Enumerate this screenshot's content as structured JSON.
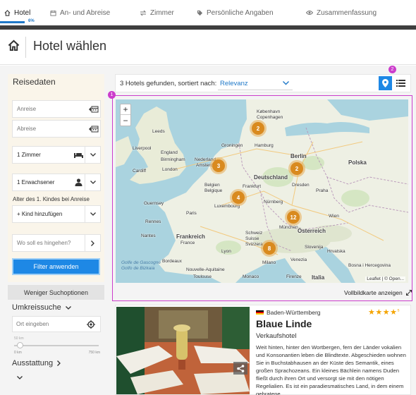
{
  "steps": [
    {
      "label": "Hotel",
      "icon": "home-icon",
      "active": true
    },
    {
      "label": "An- und Abreise",
      "icon": "calendar-icon"
    },
    {
      "label": "Zimmer",
      "icon": "exchange-icon"
    },
    {
      "label": "Persönliche Angaben",
      "icon": "tag-icon"
    },
    {
      "label": "Zusammenfassung",
      "icon": "eye-icon"
    }
  ],
  "progress": {
    "label": "6%",
    "value": 6
  },
  "page": {
    "title": "Hotel wählen"
  },
  "sidebar": {
    "title": "Reisedaten",
    "arrival_placeholder": "Anreise",
    "departure_placeholder": "Abreise",
    "rooms_value": "1 Zimmer",
    "guests_value": "1 Erwachsener",
    "kids_label": "Alter des 1. Kindes bei Anreise",
    "add_child_value": "+ Kind hinzufügen",
    "destination_placeholder": "Wo soll es hingehen?",
    "apply_label": "Filter anwenden"
  },
  "filters": {
    "fewer_label": "Weniger Suchoptionen",
    "area_search_title": "Umkreissuche",
    "location_placeholder": "Ort eingeben",
    "radius": {
      "current": "50 km",
      "min": "0 km",
      "max": "750 km",
      "value_km": 50
    },
    "amenities_title": "Ausstattung"
  },
  "results": {
    "count_text": "3 Hotels gefunden, sortiert nach:",
    "sort_value": "Relevanz",
    "badges": {
      "map": "1",
      "toggle": "2"
    }
  },
  "map": {
    "zoom_in": "+",
    "zoom_out": "−",
    "clusters": [
      "2",
      "3",
      "2",
      "4",
      "12",
      "8"
    ],
    "labels": {
      "kobenhavn": "København",
      "copenhagen": "Copenhagen",
      "hamburg": "Hamburg",
      "groningen": "Groningen",
      "berlin": "Berlin",
      "nederland": "Nederland",
      "amsterdam": "Amsterdam",
      "polska": "Polska",
      "leeds": "Leeds",
      "liverpool": "Liverpool",
      "england": "England",
      "birmingham": "Birmingham",
      "london": "London",
      "cardiff": "Cardiff",
      "belgien": "Belgien",
      "belgique": "Belgique",
      "deutschland": "Deutschland",
      "dresden": "Dresden",
      "praha": "Praha",
      "frankfurt": "Frankfurt",
      "guernsey": "Guernsey",
      "luxembourg": "Luxembourg",
      "nurnberg": "Nürnberg",
      "rennes": "Rennes",
      "paris": "Paris",
      "munchen": "München",
      "wien": "Wien",
      "osterreich": "Österreich",
      "nantes": "Nantes",
      "france": "France",
      "frankreich": "Frankreich",
      "schweiz": "Schweiz",
      "suisse": "Suisse",
      "svizzera": "Svizzera",
      "slovenija": "Slovenija",
      "hrvatska": "Hrvatska",
      "lyon": "Lyon",
      "venezia": "Venezia",
      "bordeaux": "Bordeaux",
      "milano": "Milano",
      "bosna": "Bosna i Hercegovina",
      "golfe": "Golfe de Gascogne",
      "golfo": "Golfo de Bizkaia",
      "aquitaine": "Nouvelle-Aquitaine",
      "toulouse": "Toulouse",
      "monaco": "Monaco",
      "firenze": "Firenze",
      "italia": "Italia"
    },
    "attribution": "Leaflet | © Open...",
    "fullscreen_label": "Vollbildkarte anzeigen"
  },
  "hotel": {
    "region": "Baden-Württemberg",
    "stars": "★★★★",
    "stars_sup": "s",
    "rating": 4,
    "name": "Blaue Linde",
    "type": "Verkaufshotel",
    "description": "Weit hinten, hinter den Wortbergen, fern der Länder vokalien und Konsonantien leben die Blindtexte. Abgeschieden wohnen Sie in Buchstabhausen an der Küste des Semantik, eines großen Sprachozeans. Ein kleines Bächlein namens Duden fließt durch ihren Ort und versorgt sie mit den nötigen Regelialien. Es ist ein paradiesmatisches Land, in dem einem gebratene"
  },
  "colors": {
    "accent": "#1e88e5",
    "cluster": "#d98a1f",
    "stars": "#f4a400",
    "annotation": "#cc3dcc",
    "dark_bar": "#3e3e3e"
  }
}
